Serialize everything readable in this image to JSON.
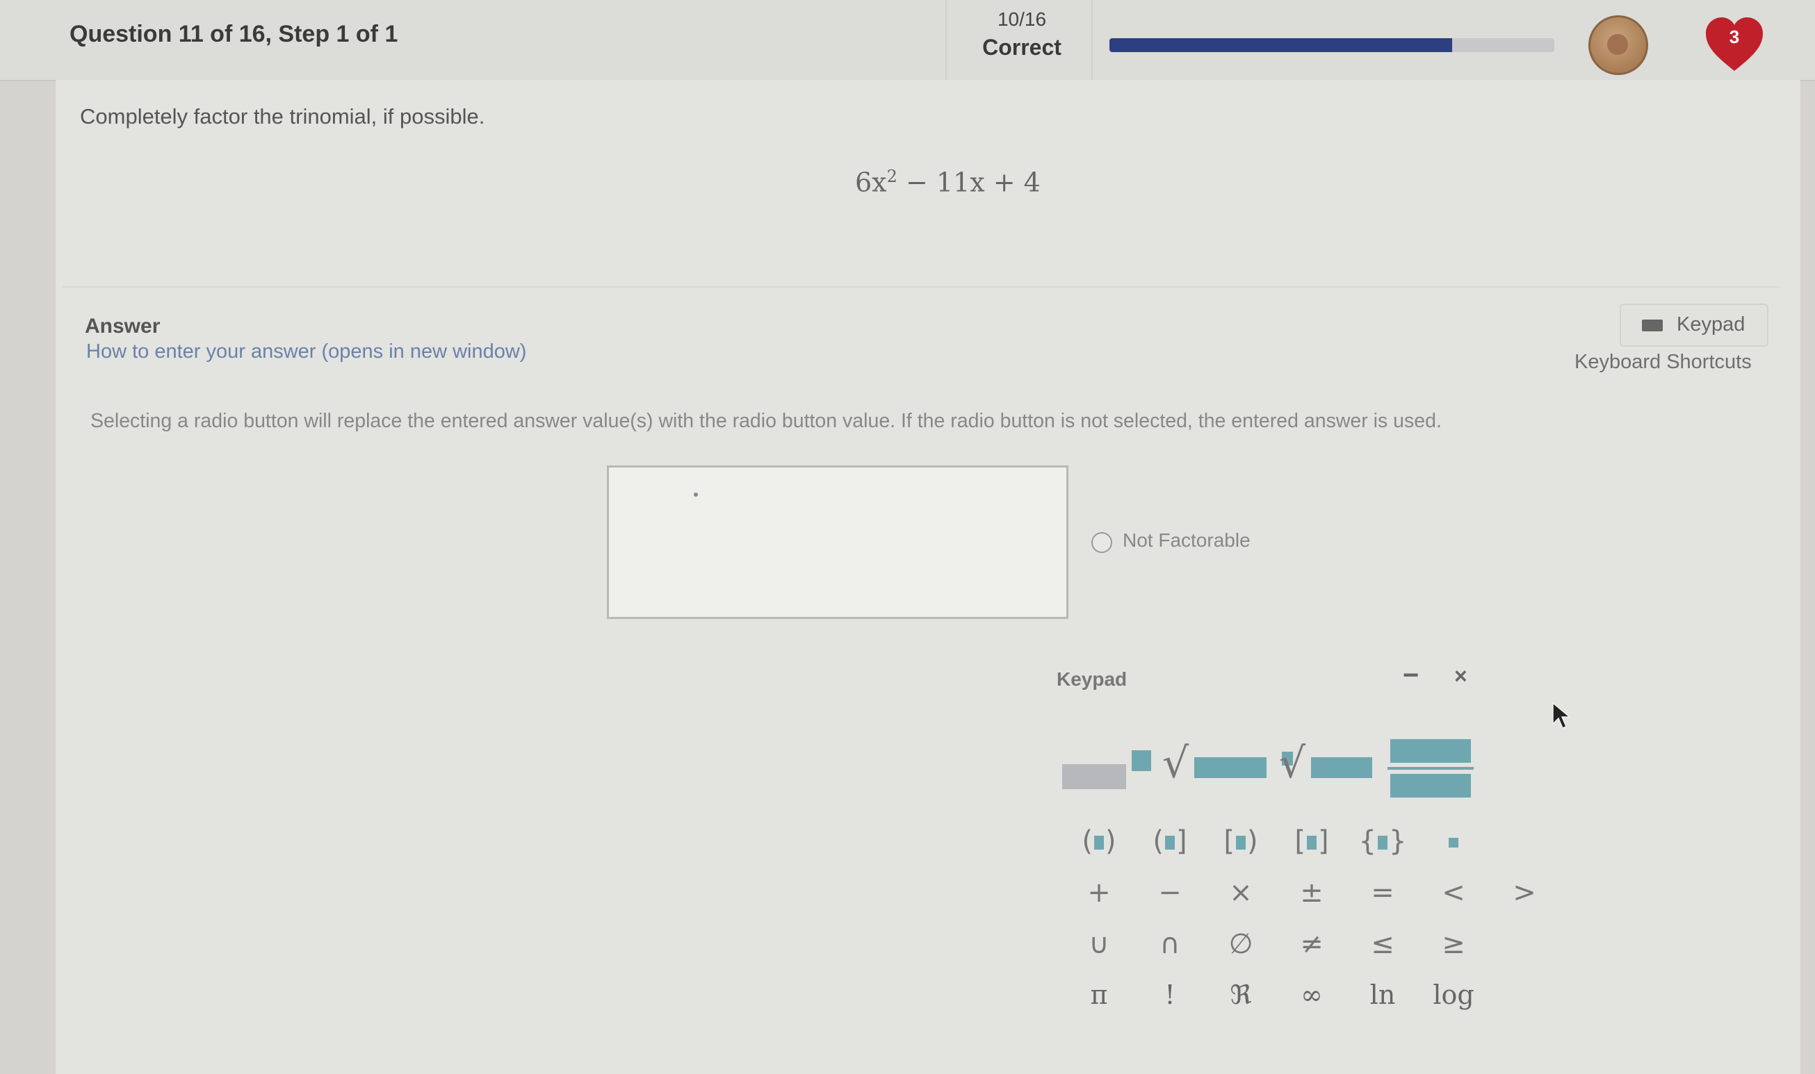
{
  "header": {
    "question_title": "Question 11 of 16, Step 1 of 1",
    "score": "10/16",
    "status": "Correct",
    "progress_fraction": 0.77,
    "lives_count": "3",
    "colors": {
      "progress_fill": "#2c3f80",
      "heart": "#c0202a"
    }
  },
  "question": {
    "prompt": "Completely factor the trinomial, if possible.",
    "expression": {
      "part1": "6x",
      "exponent": "2",
      "part2": " − 11x + 4"
    }
  },
  "answer": {
    "label": "Answer",
    "how_to_link": "How to enter your answer (opens in new window)",
    "keypad_button": "Keypad",
    "shortcuts_link": "Keyboard Shortcuts",
    "notice": "Selecting a radio button will replace the entered answer value(s) with the radio button value. If the radio button is not selected, the entered answer is used.",
    "input_value": "",
    "radio_label": "Not Factorable"
  },
  "keypad": {
    "title": "Keypad",
    "minimize_label": "−",
    "close_label": "×",
    "row_operators": [
      "+",
      "−",
      "×",
      "±",
      "=",
      "<",
      ">"
    ],
    "row_sets": [
      "∪",
      "∩",
      "∅",
      "≠",
      "≤",
      "≥"
    ],
    "row_functions": [
      "π",
      "!",
      "ℜ",
      "∞",
      "ln",
      "log"
    ]
  }
}
